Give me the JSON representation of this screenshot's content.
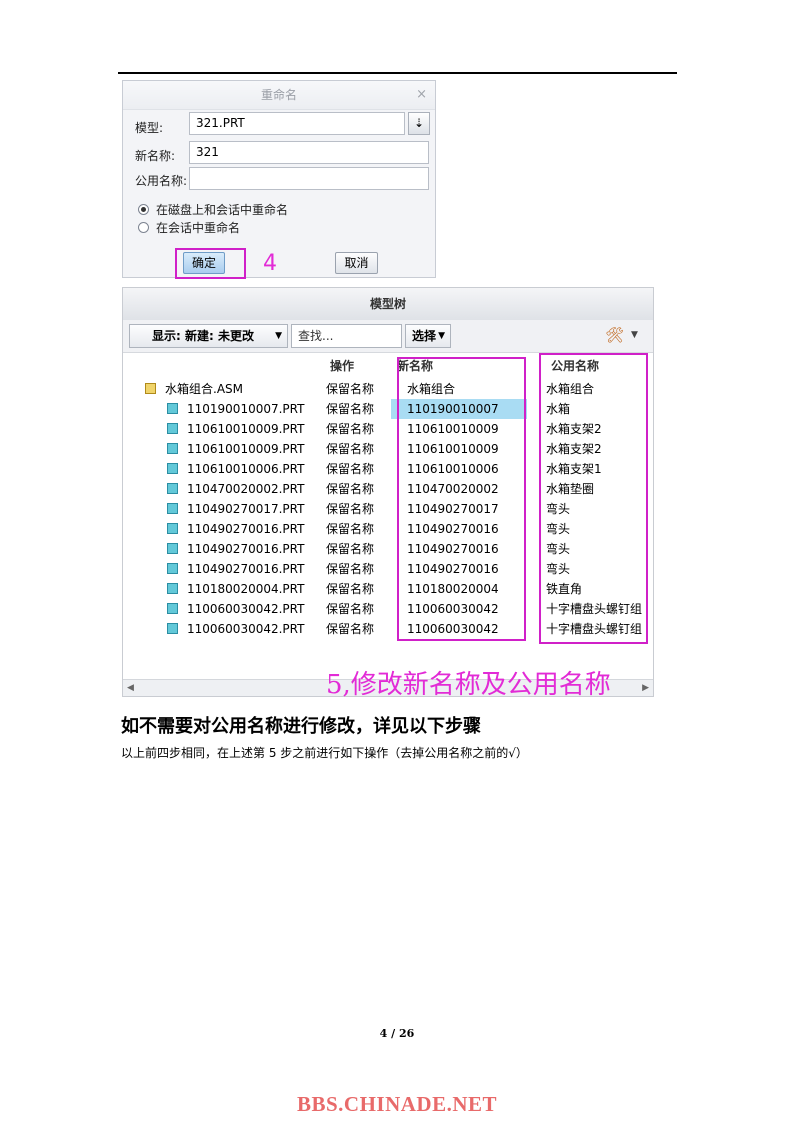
{
  "dialog": {
    "title": "重命名",
    "close_glyph": "×",
    "model_label": "模型:",
    "model_value": "321.PRT",
    "new_name_label": "新名称:",
    "new_name_value": "321",
    "common_name_label": "公用名称:",
    "common_name_value": "",
    "radio_disk": "在磁盘上和会话中重命名",
    "radio_session": "在会话中重命名",
    "ok_label": "确定",
    "cancel_label": "取消",
    "step_marker": "4"
  },
  "model_tree": {
    "title": "模型树",
    "show_dropdown": "显示: 新建: 未更改",
    "find_placeholder": "查找...",
    "select_label": "选择",
    "columns": {
      "operation": "操作",
      "new_name": "新名称",
      "common_name": "公用名称"
    },
    "rows": [
      {
        "name": "水箱组合.ASM",
        "op": "保留名称",
        "new": "水箱组合",
        "common": "水箱组合"
      },
      {
        "name": "110190010007.PRT",
        "op": "保留名称",
        "new": "110190010007",
        "common": "水箱"
      },
      {
        "name": "110610010009.PRT",
        "op": "保留名称",
        "new": "110610010009",
        "common": "水箱支架2"
      },
      {
        "name": "110610010009.PRT",
        "op": "保留名称",
        "new": "110610010009",
        "common": "水箱支架2"
      },
      {
        "name": "110610010006.PRT",
        "op": "保留名称",
        "new": "110610010006",
        "common": "水箱支架1"
      },
      {
        "name": "110470020002.PRT",
        "op": "保留名称",
        "new": "110470020002",
        "common": "水箱垫圈"
      },
      {
        "name": "110490270017.PRT",
        "op": "保留名称",
        "new": "110490270017",
        "common": "弯头"
      },
      {
        "name": "110490270016.PRT",
        "op": "保留名称",
        "new": "110490270016",
        "common": "弯头"
      },
      {
        "name": "110490270016.PRT",
        "op": "保留名称",
        "new": "110490270016",
        "common": "弯头"
      },
      {
        "name": "110490270016.PRT",
        "op": "保留名称",
        "new": "110490270016",
        "common": "弯头"
      },
      {
        "name": "110180020004.PRT",
        "op": "保留名称",
        "new": "110180020004",
        "common": "铁直角"
      },
      {
        "name": "110060030042.PRT",
        "op": "保留名称",
        "new": "110060030042",
        "common": "十字槽盘头螺钉组"
      },
      {
        "name": "110060030042.PRT",
        "op": "保留名称",
        "new": "110060030042",
        "common": "十字槽盘头螺钉组"
      }
    ]
  },
  "annotation_step5": "5,修改新名称及公用名称",
  "heading": "如不需要对公用名称进行修改，详见以下步骤",
  "paragraph": "以上前四步相同，在上述第 5 步之前进行如下操作（去掉公用名称之前的√）",
  "page_number": "4 / 26",
  "watermark_footer": "BBS.CHINADE.NET",
  "colors": {
    "highlight": "#d020c8",
    "footer": "#e86a6a"
  }
}
